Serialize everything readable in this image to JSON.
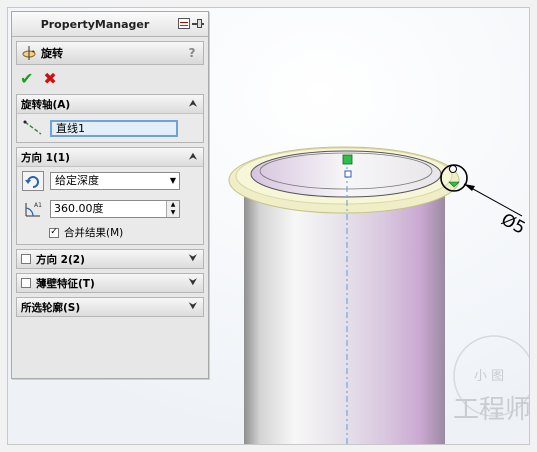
{
  "property_manager": {
    "title": "PropertyManager",
    "feature_name": "旋转",
    "help": "?",
    "ok_symbol": "✔",
    "cancel_symbol": "✖"
  },
  "groups": {
    "axis": {
      "title": "旋转轴(A)",
      "value": "直线1"
    },
    "direction1": {
      "title": "方向 1(1)",
      "end_condition": "给定深度",
      "angle": "360.00度",
      "merge_label": "合并结果(M)",
      "merge_checked": true
    },
    "direction2": {
      "title": "方向 2(2)"
    },
    "thin": {
      "title": "薄壁特征(T)"
    },
    "contours": {
      "title": "所选轮廓(S)"
    }
  },
  "viewport": {
    "dimension_label": "Ø5",
    "watermark_small": "小 图",
    "watermark_large": "工程师"
  },
  "colors": {
    "ok": "#1aa01a",
    "cancel": "#d01010",
    "ring": "#f1f0c0",
    "axis_line": "#5a9fd8"
  }
}
